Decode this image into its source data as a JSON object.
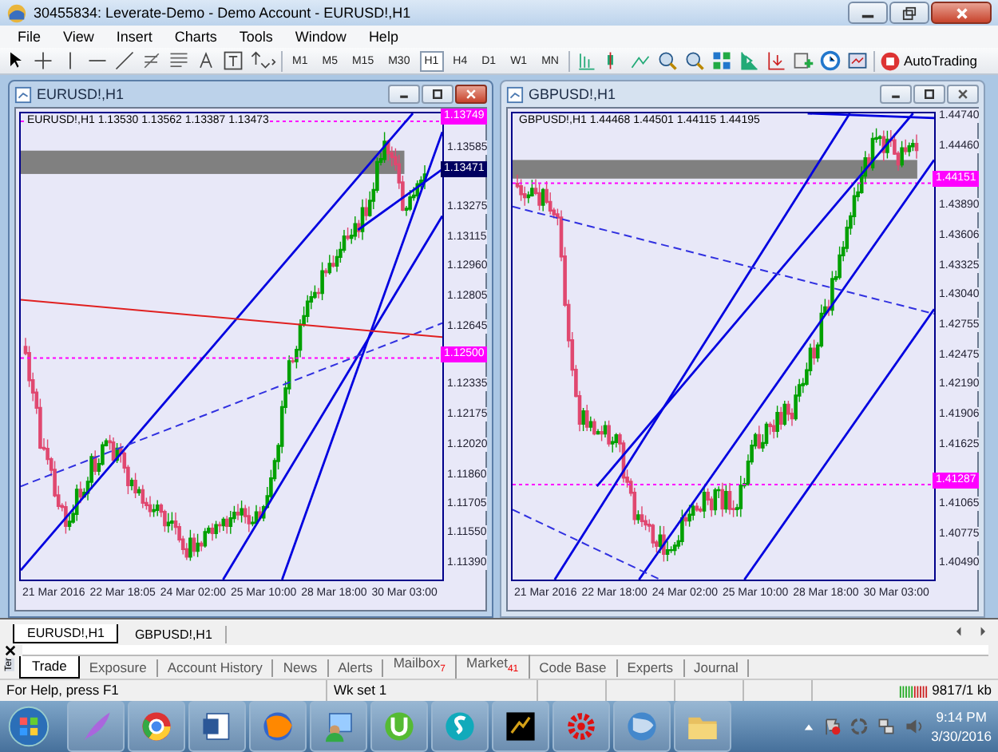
{
  "window": {
    "title": "30455834: Leverate-Demo - Demo Account - EURUSD!,H1"
  },
  "menu": [
    "File",
    "View",
    "Insert",
    "Charts",
    "Tools",
    "Window",
    "Help"
  ],
  "toolbar": {
    "timeframes": [
      {
        "label": "M1",
        "selected": false
      },
      {
        "label": "M5",
        "selected": false
      },
      {
        "label": "M15",
        "selected": false
      },
      {
        "label": "M30",
        "selected": false
      },
      {
        "label": "H1",
        "selected": true
      },
      {
        "label": "H4",
        "selected": false
      },
      {
        "label": "D1",
        "selected": false
      },
      {
        "label": "W1",
        "selected": false
      },
      {
        "label": "MN",
        "selected": false
      }
    ],
    "autotrading": "AutoTrading"
  },
  "charts": [
    {
      "title": "EURUSD!,H1",
      "active": true,
      "header": "EURUSD!,H1  1.13530 1.13562 1.13387 1.13473",
      "price_ticks": [
        "1.13585",
        "1.13275",
        "1.13115",
        "1.12960",
        "1.12805",
        "1.12645",
        "1.12335",
        "1.12175",
        "1.12020",
        "1.11860",
        "1.11705",
        "1.11550",
        "1.11390"
      ],
      "price_tags": [
        {
          "label": "1.13749",
          "kind": "level"
        },
        {
          "label": "1.13471",
          "kind": "bid"
        },
        {
          "label": "1.12500",
          "kind": "level"
        }
      ],
      "time_labels": [
        "21 Mar 2016",
        "22 Mar 18:05",
        "24 Mar 02:00",
        "25 Mar 10:00",
        "28 Mar 18:00",
        "30 Mar 03:00"
      ]
    },
    {
      "title": "GBPUSD!,H1",
      "active": false,
      "header": "GBPUSD!,H1  1.44468 1.44501 1.44115 1.44195",
      "price_ticks": [
        "1.44740",
        "1.44460",
        "1.43890",
        "1.43606",
        "1.43325",
        "1.43040",
        "1.42755",
        "1.42475",
        "1.42190",
        "1.41906",
        "1.41625",
        "1.41065",
        "1.40775",
        "1.40490"
      ],
      "price_tags": [
        {
          "label": "1.44151",
          "kind": "level"
        },
        {
          "label": "1.41287",
          "kind": "level"
        }
      ],
      "time_labels": [
        "21 Mar 2016",
        "22 Mar 18:00",
        "24 Mar 02:00",
        "25 Mar 10:00",
        "28 Mar 18:00",
        "30 Mar 03:00"
      ]
    }
  ],
  "chart_tabs": [
    {
      "label": "EURUSD!,H1",
      "selected": true
    },
    {
      "label": "GBPUSD!,H1",
      "selected": false
    }
  ],
  "terminal": {
    "side_label": "Ter",
    "tabs": [
      {
        "label": "Trade",
        "selected": true
      },
      {
        "label": "Exposure",
        "selected": false
      },
      {
        "label": "Account History",
        "selected": false
      },
      {
        "label": "News",
        "selected": false
      },
      {
        "label": "Alerts",
        "selected": false
      },
      {
        "label": "Mailbox",
        "badge": "7",
        "selected": false
      },
      {
        "label": "Market",
        "badge": "41",
        "selected": false
      },
      {
        "label": "Code Base",
        "selected": false
      },
      {
        "label": "Experts",
        "selected": false
      },
      {
        "label": "Journal",
        "selected": false
      }
    ]
  },
  "status_bar": {
    "help": "For Help, press F1",
    "profile": "Wk set 1",
    "traffic": "9817/1 kb"
  },
  "taskbar": {
    "time": "9:14 PM",
    "date": "3/30/2016"
  }
}
